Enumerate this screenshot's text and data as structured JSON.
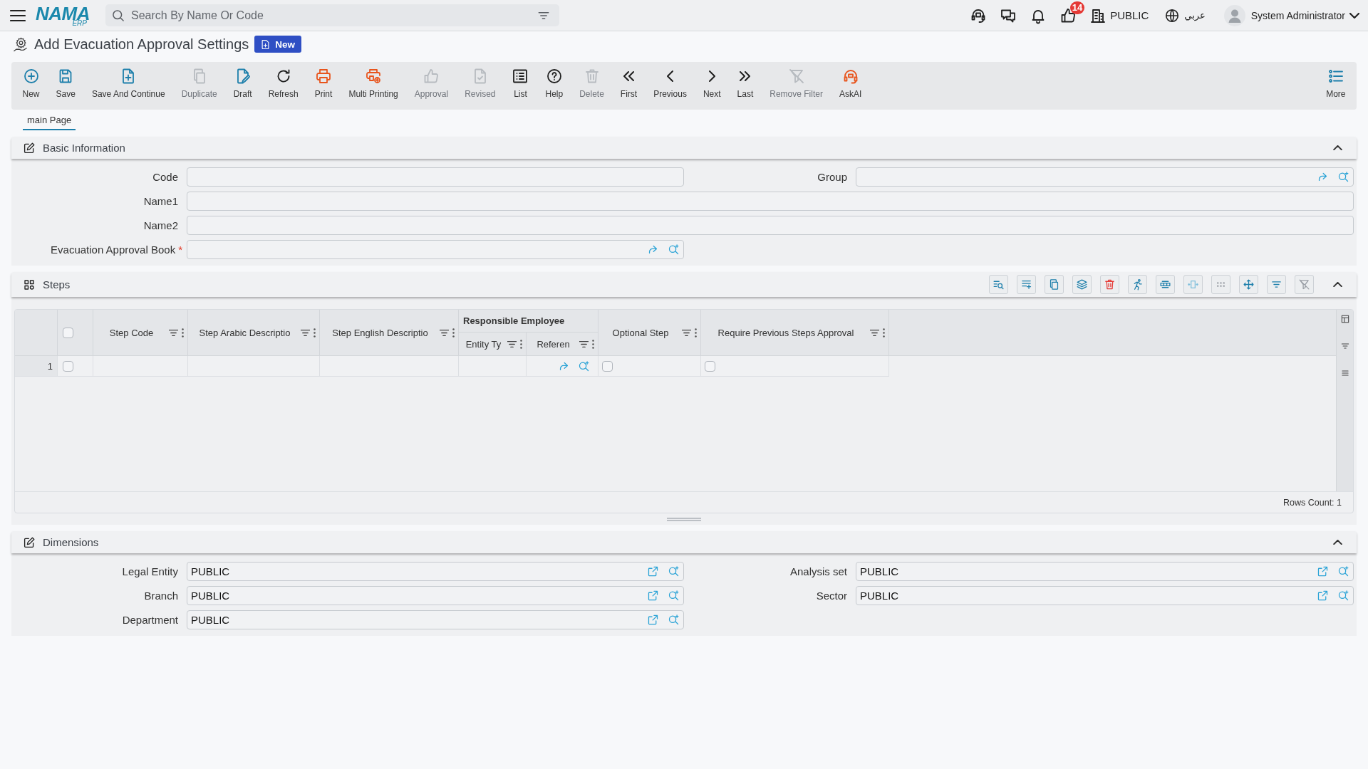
{
  "header": {
    "logo": {
      "name": "NAMA",
      "suffix": "ERP"
    },
    "search": {
      "placeholder": "Search By Name Or Code"
    },
    "notification_count": "14",
    "company": "PUBLIC",
    "language": "عربي",
    "user": "System Administrator"
  },
  "page": {
    "title": "Add Evacuation Approval Settings",
    "badge": "New"
  },
  "toolbar": [
    {
      "label": "New",
      "kind": "new",
      "disabled": false
    },
    {
      "label": "Save",
      "kind": "save",
      "disabled": false
    },
    {
      "label": "Save And Continue",
      "kind": "savecontinue",
      "disabled": false
    },
    {
      "label": "Duplicate",
      "kind": "duplicate",
      "disabled": true
    },
    {
      "label": "Draft",
      "kind": "draft",
      "disabled": false
    },
    {
      "label": "Refresh",
      "kind": "refresh",
      "disabled": false
    },
    {
      "label": "Print",
      "kind": "print",
      "disabled": false
    },
    {
      "label": "Multi Printing",
      "kind": "multiprint",
      "disabled": false
    },
    {
      "label": "Approval",
      "kind": "approval",
      "disabled": true
    },
    {
      "label": "Revised",
      "kind": "revised",
      "disabled": true
    },
    {
      "label": "List",
      "kind": "list",
      "disabled": false
    },
    {
      "label": "Help",
      "kind": "help",
      "disabled": false
    },
    {
      "label": "Delete",
      "kind": "delete",
      "disabled": true
    },
    {
      "label": "First",
      "kind": "first",
      "disabled": false
    },
    {
      "label": "Previous",
      "kind": "previous",
      "disabled": false
    },
    {
      "label": "Next",
      "kind": "next",
      "disabled": false
    },
    {
      "label": "Last",
      "kind": "last",
      "disabled": false
    },
    {
      "label": "Remove Filter",
      "kind": "unfilter",
      "disabled": true
    },
    {
      "label": "AskAI",
      "kind": "askai",
      "disabled": false
    },
    {
      "label": "More",
      "kind": "more",
      "disabled": false
    }
  ],
  "tabs": [
    {
      "label": "main Page",
      "selected": true
    }
  ],
  "basic_information": {
    "title": "Basic Information",
    "expanded": true,
    "rows": [
      [
        {
          "label": "Code",
          "kind": "text",
          "full_width": false
        },
        {
          "label": "Group",
          "kind": "lookup",
          "full_width": false
        }
      ],
      [
        {
          "label": "Name1",
          "kind": "text",
          "full_width": true
        }
      ],
      [
        {
          "label": "Name2",
          "kind": "text",
          "full_width": true
        }
      ],
      [
        {
          "label": "Evacuation Approval Book",
          "kind": "lookup",
          "full_width": false,
          "required_mark": "*"
        }
      ]
    ]
  },
  "steps": {
    "title": "Steps",
    "expanded": true,
    "grid": {
      "select_all_checked": false,
      "columns": [
        {
          "label": "Step Code",
          "kind": "text"
        },
        {
          "label": "Step Arabic Descriptio",
          "kind": "text"
        },
        {
          "label": "Step English Descriptio",
          "kind": "text"
        },
        {
          "group": "Responsible Employee",
          "columns": [
            {
              "label": "Entity Ty",
              "kind": "text"
            },
            {
              "label": "Referen",
              "kind": "lookup"
            }
          ]
        },
        {
          "label": "Optional Step",
          "kind": "check"
        },
        {
          "label": "Require Previous Steps Approval",
          "kind": "check"
        }
      ],
      "rows": [
        {
          "number": "1",
          "selected": false,
          "checks": [
            false,
            false
          ]
        }
      ],
      "rows_count": "Rows Count: 1"
    }
  },
  "dimensions": {
    "title": "Dimensions",
    "expanded": true,
    "rows": [
      [
        {
          "label": "Legal Entity",
          "kind": "link",
          "value": "PUBLIC",
          "full_width": false
        },
        {
          "label": "Analysis set",
          "kind": "link",
          "value": "PUBLIC",
          "full_width": false
        }
      ],
      [
        {
          "label": "Branch",
          "kind": "link",
          "value": "PUBLIC",
          "full_width": false
        },
        {
          "label": "Sector",
          "kind": "link",
          "value": "PUBLIC",
          "full_width": false
        }
      ],
      [
        {
          "label": "Department",
          "kind": "link",
          "value": "PUBLIC",
          "full_width": false
        }
      ]
    ]
  }
}
